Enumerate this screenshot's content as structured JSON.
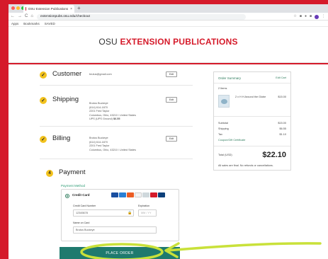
{
  "colors": {
    "accent_red": "#d51a2a",
    "check_yellow": "#f2c21d",
    "green": "#1f7a6e",
    "highlight": "#c9e13a"
  },
  "browser": {
    "tab_title": "OSU Extension Publications",
    "tab_close": "×",
    "new_tab": "+",
    "nav": {
      "back": "←",
      "forward": "→",
      "reload": "C",
      "home": "⌂"
    },
    "url": "extensionpubs.osu.edu/checkout",
    "bookmarks": {
      "apps": "Apps",
      "bookmarks": "Bookmarks",
      "saved": "SAVED"
    }
  },
  "site": {
    "brand_part1": "OSU",
    "brand_part2": "EXTENSION PUBLICATIONS"
  },
  "steps": {
    "customer": {
      "title": "Customer",
      "email": "brutus@gmail.com",
      "edit": "Edit"
    },
    "shipping": {
      "title": "Shipping",
      "lines": [
        "Brutus Buckeye",
        "(614) 614-1870",
        "2201 Fred Taylor",
        "Columbus, Ohio, 43210 / United States",
        "UPS (UPS Ground)"
      ],
      "price": "$6.55",
      "edit": "Edit"
    },
    "billing": {
      "title": "Billing",
      "lines": [
        "Brutus Buckeye",
        "(614) 614-1870",
        "2201 Fred Taylor",
        "Columbus, Ohio, 43210 / United States"
      ],
      "edit": "Edit"
    }
  },
  "summary": {
    "title": "Order Summary",
    "edit_cart": "Edit Cart",
    "items_count": "2 Items",
    "item_name": "2 x H H Around the Globe",
    "item_price": "$15.00",
    "subtotal_label": "Subtotal",
    "subtotal": "$15.00",
    "shipping_label": "Shipping",
    "shipping": "$6.55",
    "tax_label": "Tax",
    "tax": "$1.10",
    "coupon": "Coupon/Gift Certificate",
    "total_label": "Total (USD)",
    "total": "$22.10",
    "note": "All sales are final. No refunds or cancellations."
  },
  "payment": {
    "number": "4",
    "title": "Payment",
    "method_label": "Payment Method",
    "cc_label": "Credit Card",
    "cc_number_label": "Credit Card Number",
    "cc_number_value": "12345678",
    "expiration_label": "Expiration",
    "expiration_placeholder": "MM / YY",
    "name_label": "Name on Card",
    "name_value": "Brutus Buckeye",
    "place_order": "PLACE ORDER"
  }
}
